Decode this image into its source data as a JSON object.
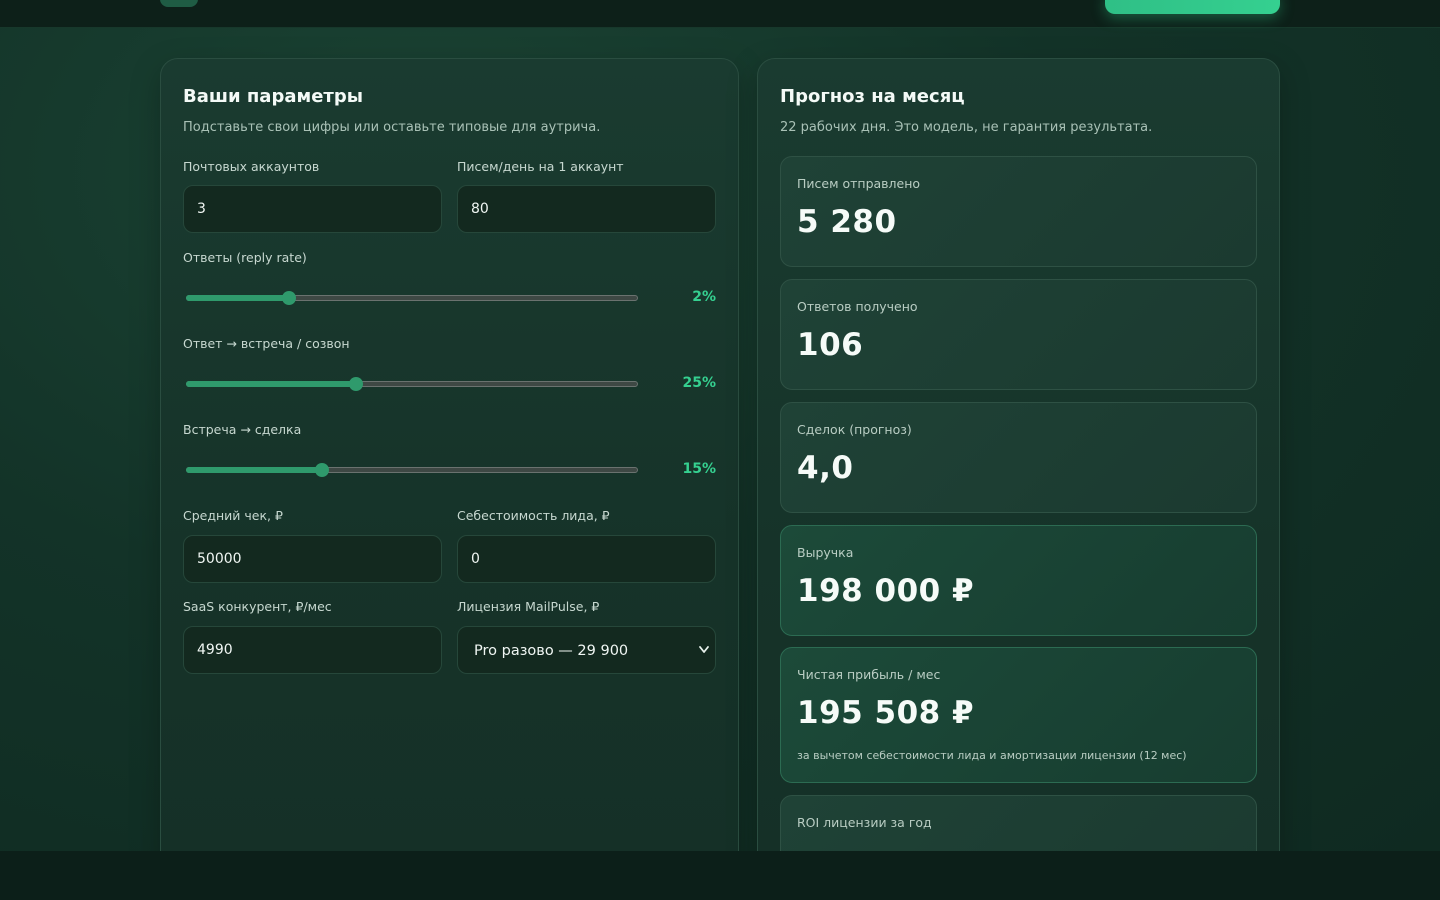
{
  "params": {
    "title": "Ваши параметры",
    "subtitle": "Подставьте свои цифры или оставьте типовые для аутрича.",
    "accounts_label": "Почтовых аккаунтов",
    "accounts_value": "3",
    "letters_label": "Писем/день на 1 аккаунт",
    "letters_value": "80",
    "reply_label": "Ответы (reply rate)",
    "reply_value": "2%",
    "reply_level": 0.2275,
    "meeting_label": "Ответ → встреча / созвон",
    "meeting_value": "25%",
    "meeting_level": 0.376,
    "deal_label": "Встреча → сделка",
    "deal_value": "15%",
    "deal_level": 0.3,
    "avg_check_label": "Средний чек, ₽",
    "avg_check_value": "50000",
    "lead_cost_label": "Себестоимость лида, ₽",
    "lead_cost_value": "0",
    "saas_label": "SaaS конкурент, ₽/мес",
    "saas_value": "4990",
    "license_label": "Лицензия MailPulse, ₽",
    "license_value": "Pro разово — 29 900"
  },
  "forecast": {
    "title": "Прогноз на месяц",
    "subtitle": "22 рабочих дня. Это модель, не гарантия результата.",
    "sent_label": "Писем отправлено",
    "sent_value": "5 280",
    "replies_label": "Ответов получено",
    "replies_value": "106",
    "deals_label": "Сделок (прогноз)",
    "deals_value": "4,0",
    "revenue_label": "Выручка",
    "revenue_value": "198 000 ₽",
    "profit_label": "Чистая прибыль / мес",
    "profit_value": "195 508 ₽",
    "profit_note": "за вычетом себестоимости лида и амортизации лицензии (12 мес)",
    "roi_label": "ROI лицензии за год"
  },
  "colors": {
    "accent": "#35d090",
    "slider": "#2f9a6c"
  }
}
